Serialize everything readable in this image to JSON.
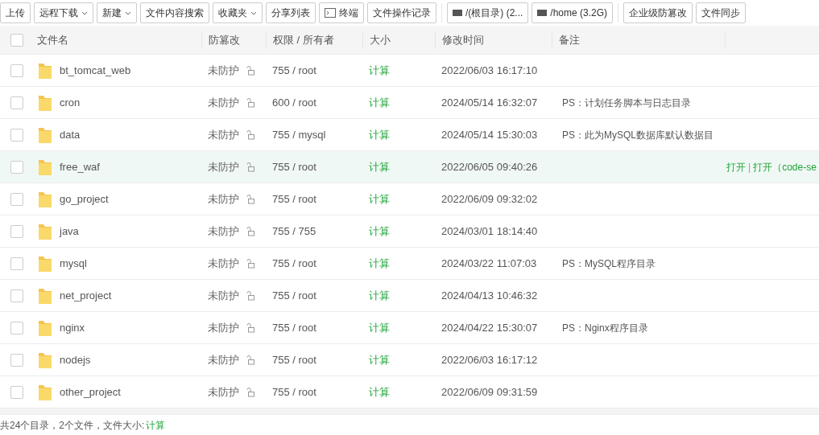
{
  "toolbar": [
    [
      {
        "label": "上传",
        "kind": "plain"
      },
      {
        "label": "远程下载",
        "kind": "dropdown"
      },
      {
        "label": "新建",
        "kind": "dropdown"
      },
      {
        "label": "文件内容搜索",
        "kind": "plain"
      },
      {
        "label": "收藏夹",
        "kind": "dropdown"
      },
      {
        "label": "分享列表",
        "kind": "plain"
      },
      {
        "label": "终端",
        "kind": "terminal"
      },
      {
        "label": "文件操作记录",
        "kind": "plain"
      }
    ],
    [
      {
        "label": "/(根目录) (2...",
        "kind": "disk"
      },
      {
        "label": "/home (3.2G)",
        "kind": "disk"
      }
    ],
    [
      {
        "label": "企业级防篡改",
        "kind": "plain"
      },
      {
        "label": "文件同步",
        "kind": "plain"
      }
    ]
  ],
  "table": {
    "all_checked": false,
    "columns": [
      "文件名",
      "防篡改",
      "权限 / 所有者",
      "大小",
      "修改时间",
      "备注"
    ],
    "rows": [
      {
        "name": "bt_tomcat_web",
        "protect": "未防护",
        "perm": "755 / root",
        "size": "计算",
        "mtime": "2022/06/03 16:17:10",
        "checked": false,
        "highlighted": false
      },
      {
        "name": "cron",
        "protect": "未防护",
        "perm": "600 / root",
        "size": "计算",
        "mtime": "2024/05/14 16:32:07",
        "note": "PS：计划任务脚本与日志目录",
        "checked": false,
        "highlighted": false
      },
      {
        "name": "data",
        "protect": "未防护",
        "perm": "755 / mysql",
        "size": "计算",
        "mtime": "2024/05/14 15:30:03",
        "note": "PS：此为MySQL数据库默认数据目",
        "checked": false,
        "highlighted": false
      },
      {
        "name": "free_waf",
        "protect": "未防护",
        "perm": "755 / root",
        "size": "计算",
        "mtime": "2022/06/05 09:40:26",
        "checked": false,
        "highlighted": true,
        "actions": [
          "打开",
          "打开（code-se"
        ],
        "action_separator": "|"
      },
      {
        "name": "go_project",
        "protect": "未防护",
        "perm": "755 / root",
        "size": "计算",
        "mtime": "2022/06/09 09:32:02",
        "checked": false,
        "highlighted": false
      },
      {
        "name": "java",
        "protect": "未防护",
        "perm": "755 / 755",
        "size": "计算",
        "mtime": "2024/03/01 18:14:40",
        "checked": false,
        "highlighted": false
      },
      {
        "name": "mysql",
        "protect": "未防护",
        "perm": "755 / root",
        "size": "计算",
        "mtime": "2024/03/22 11:07:03",
        "note": "PS：MySQL程序目录",
        "checked": false,
        "highlighted": false
      },
      {
        "name": "net_project",
        "protect": "未防护",
        "perm": "755 / root",
        "size": "计算",
        "mtime": "2024/04/13 10:46:32",
        "checked": false,
        "highlighted": false
      },
      {
        "name": "nginx",
        "protect": "未防护",
        "perm": "755 / root",
        "size": "计算",
        "mtime": "2024/04/22 15:30:07",
        "note": "PS：Nginx程序目录",
        "checked": false,
        "highlighted": false
      },
      {
        "name": "nodejs",
        "protect": "未防护",
        "perm": "755 / root",
        "size": "计算",
        "mtime": "2022/06/03 16:17:12",
        "checked": false,
        "highlighted": false
      },
      {
        "name": "other_project",
        "protect": "未防护",
        "perm": "755 / root",
        "size": "计算",
        "mtime": "2022/06/09 09:31:59",
        "checked": false,
        "highlighted": false
      }
    ]
  },
  "status_bar": {
    "summary": "共24个目录，2个文件，文件大小:",
    "link": "计算"
  }
}
